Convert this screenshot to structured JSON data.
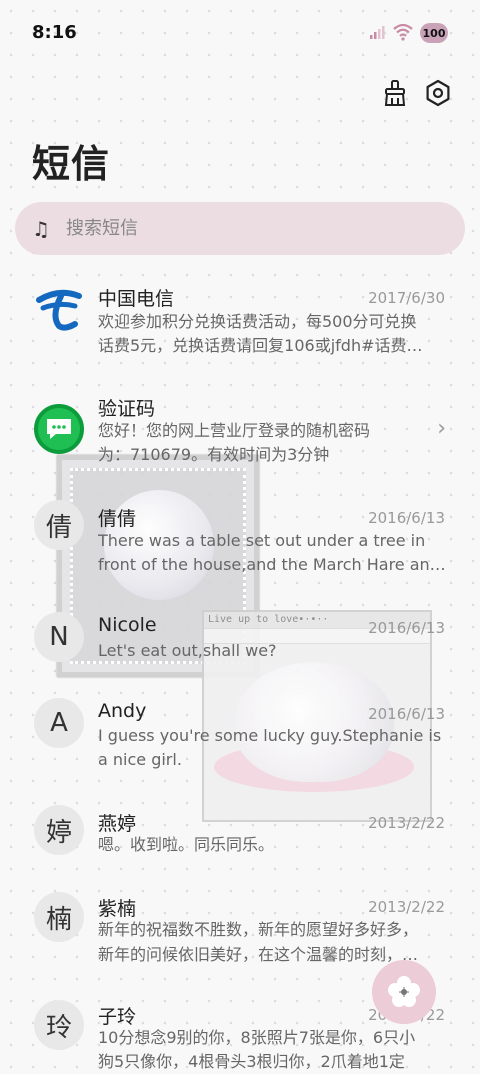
{
  "status": {
    "time": "8:16",
    "battery": "100"
  },
  "header": {
    "title": "短信"
  },
  "search": {
    "placeholder": "搜索短信"
  },
  "decor": {
    "window_caption": "Live up to love•·•··"
  },
  "conversations": [
    {
      "name": "中国电信",
      "date": "2017/6/30",
      "line1": "欢迎参加积分兑换话费活动，每500分可兑换",
      "line2": "话费5元，兑换话费请回复106或jfdh#话费…"
    },
    {
      "name": "验证码",
      "date": "",
      "line1": "您好！您的网上营业厅登录的随机密码",
      "line2": "为：710679。有效时间为3分钟"
    },
    {
      "avatar": "倩",
      "name": "倩倩",
      "date": "2016/6/13",
      "line1": "There was a table set out under a tree in",
      "line2": "front of the house,and the March Hare an…"
    },
    {
      "avatar": "N",
      "name": "Nicole",
      "date": "2016/6/13",
      "line1": "Let's eat out,shall we?",
      "line2": ""
    },
    {
      "avatar": "A",
      "name": "Andy",
      "date": "2016/6/13",
      "line1": "I guess you're some lucky guy.Stephanie is",
      "line2": "a nice girl."
    },
    {
      "avatar": "婷",
      "name": "燕婷",
      "date": "2013/2/22",
      "line1": "嗯。收到啦。同乐同乐。",
      "line2": ""
    },
    {
      "avatar": "楠",
      "name": "紫楠",
      "date": "2013/2/22",
      "line1": "新年的祝福数不胜数，新年的愿望好多好多，",
      "line2": "新年的问候依旧美好，在这个温馨的时刻，…"
    },
    {
      "avatar": "玲",
      "name": "子玲",
      "date": "2013/2/22",
      "line1": "10分想念9别的你，8张照片7张是你，6只小",
      "line2": "狗5只像你，4根骨头3根归你，2爪着地1定"
    }
  ]
}
